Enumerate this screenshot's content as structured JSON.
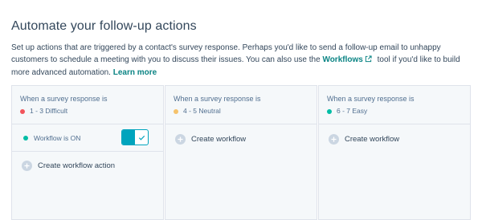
{
  "section": {
    "title": "Automate your follow-up actions",
    "description_part1": "Set up actions that are triggered by a contact's survey response. Perhaps you'd like to send a follow-up email to unhappy customers to schedule a meeting with you to discuss their issues. You can also use the ",
    "workflows_link": "Workflows",
    "description_part2": " tool if you'd like to build more advanced automation. ",
    "learn_more_link": "Learn more"
  },
  "columns": [
    {
      "when_label": "When a survey response is",
      "range_label": "1 - 3 Difficult",
      "dot_color": "#f2545b",
      "workflow_status": "Workflow is ON",
      "workflow_on": true,
      "action_label": "Create workflow action"
    },
    {
      "when_label": "When a survey response is",
      "range_label": "4 - 5 Neutral",
      "dot_color": "#f5c26b",
      "action_label": "Create workflow"
    },
    {
      "when_label": "When a survey response is",
      "range_label": "6 - 7 Easy",
      "dot_color": "#00bda5",
      "action_label": "Create workflow"
    }
  ],
  "colors": {
    "link": "#0b8484",
    "toggle_on": "#00a4bd",
    "status_on": "#00bda5",
    "plus_bg": "#cbd6e2"
  },
  "icons": {
    "external_link": "external-link-icon",
    "plus": "plus-icon",
    "check": "check-icon"
  }
}
